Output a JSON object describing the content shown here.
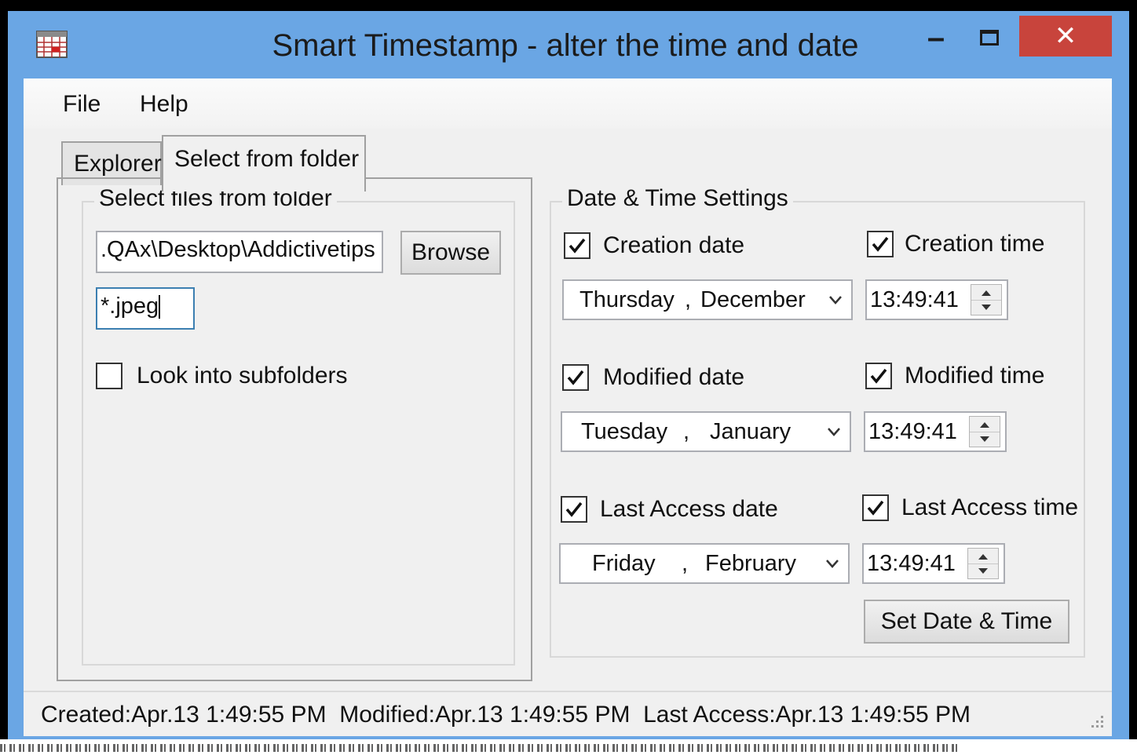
{
  "window": {
    "title": "Smart Timestamp - alter the time and date",
    "app_icon": "calendar-icon",
    "controls": {
      "minimize_glyph": "–",
      "close_glyph": "✕"
    }
  },
  "menu": {
    "items": [
      "File",
      "Help"
    ]
  },
  "tabs": {
    "items": [
      "Explorer",
      "Select from folder"
    ],
    "active": "Select from folder"
  },
  "folder_panel": {
    "group_label": "Select files from folder",
    "path_value": ".QAx\\Desktop\\Addictivetips",
    "browse_label": "Browse",
    "filter_value": "*.jpeg",
    "subfolders_label": "Look into subfolders",
    "subfolders_checked": false
  },
  "settings": {
    "group_label": "Date & Time Settings",
    "rows": [
      {
        "date_label": "Creation date",
        "date_checked": true,
        "time_label": "Creation time",
        "time_checked": true,
        "day": "Thursday",
        "month": "December",
        "time": "13:49:41"
      },
      {
        "date_label": "Modified date",
        "date_checked": true,
        "time_label": "Modified time",
        "time_checked": true,
        "day": "Tuesday",
        "month": "January",
        "time": "13:49:41"
      },
      {
        "date_label": "Last Access date",
        "date_checked": true,
        "time_label": "Last Access time",
        "time_checked": true,
        "day": "Friday",
        "month": "February",
        "time": "13:49:41"
      }
    ],
    "separator": ",",
    "set_button_label": "Set Date & Time"
  },
  "status": {
    "text": "Created:Apr.13 1:49:55 PM  Modified:Apr.13 1:49:55 PM  Last Access:Apr.13 1:49:55 PM"
  },
  "colors": {
    "title_bar": "#6aa6e4",
    "close_button": "#c8443c",
    "client_bg": "#f0f0f0"
  }
}
